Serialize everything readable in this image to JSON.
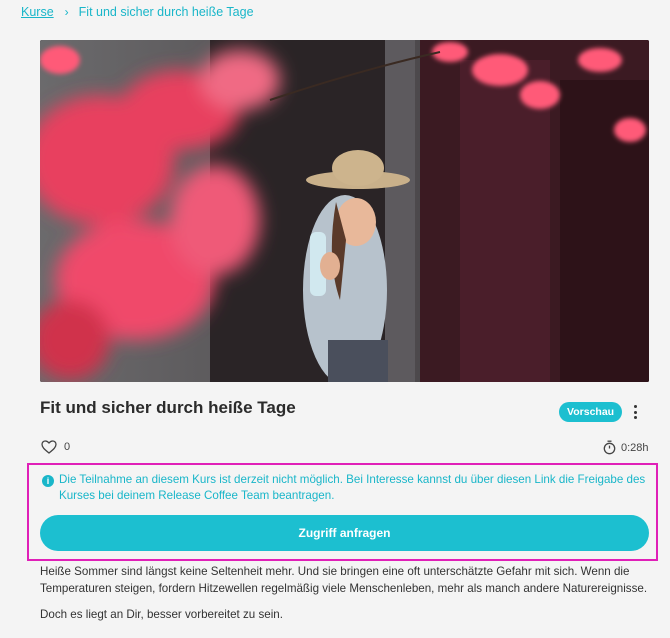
{
  "breadcrumb": {
    "root": "Kurse",
    "separator": "›",
    "current": "Fit und sicher durch heiße Tage"
  },
  "course": {
    "title": "Fit und sicher durch heiße Tage",
    "badge": "Vorschau",
    "likes": "0",
    "duration": "0:28h",
    "hero_image": "woman-in-straw-hat-drinking-water-behind-red-leaves"
  },
  "notice": {
    "icon": "info-icon",
    "text": "Die Teilnahme an diesem Kurs ist derzeit nicht möglich. Bei Interesse kannst du über diesen Link die Freigabe des Kurses bei deinem Release Coffee Team beantragen."
  },
  "cta": {
    "label": "Zugriff anfragen"
  },
  "description": {
    "paragraph1": "Heiße Sommer sind längst keine Seltenheit mehr. Und sie bringen eine oft unterschätzte Gefahr mit sich. Wenn die Temperaturen steigen, fordern Hitzewellen regelmäßig viele Menschenleben, mehr als manch andere Naturereignisse.",
    "paragraph2": "Doch es liegt an Dir, besser vorbereitet zu sein."
  },
  "colors": {
    "accent": "#1cbfd0",
    "highlight_frame": "#e020b8",
    "background": "#f4f4f4"
  }
}
